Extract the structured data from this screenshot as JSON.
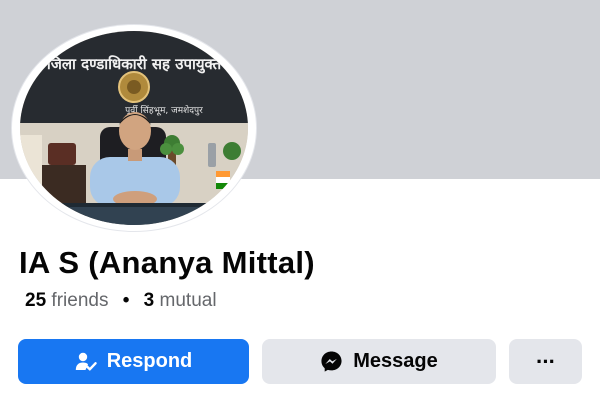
{
  "profile": {
    "name": "IA S (Ananya Mittal)",
    "friends_count": "25",
    "friends_label": "friends",
    "separator": "•",
    "mutual_count": "3",
    "mutual_label": "mutual",
    "photo_sign_text": "जिला दण्डाधिकारी सह उपायुक्त",
    "photo_sign_subtext": "पूर्वी सिंहभूम, जमशेदपुर"
  },
  "actions": {
    "respond_label": "Respond",
    "message_label": "Message",
    "more_label": "···"
  },
  "icons": {
    "respond": "person-check-icon",
    "message": "messenger-icon",
    "more": "more-dots-icon"
  },
  "colors": {
    "primary": "#1877f2",
    "secondary_button": "#e4e6eb",
    "cover": "#cfd1d6",
    "secondary_text": "#65676b"
  }
}
